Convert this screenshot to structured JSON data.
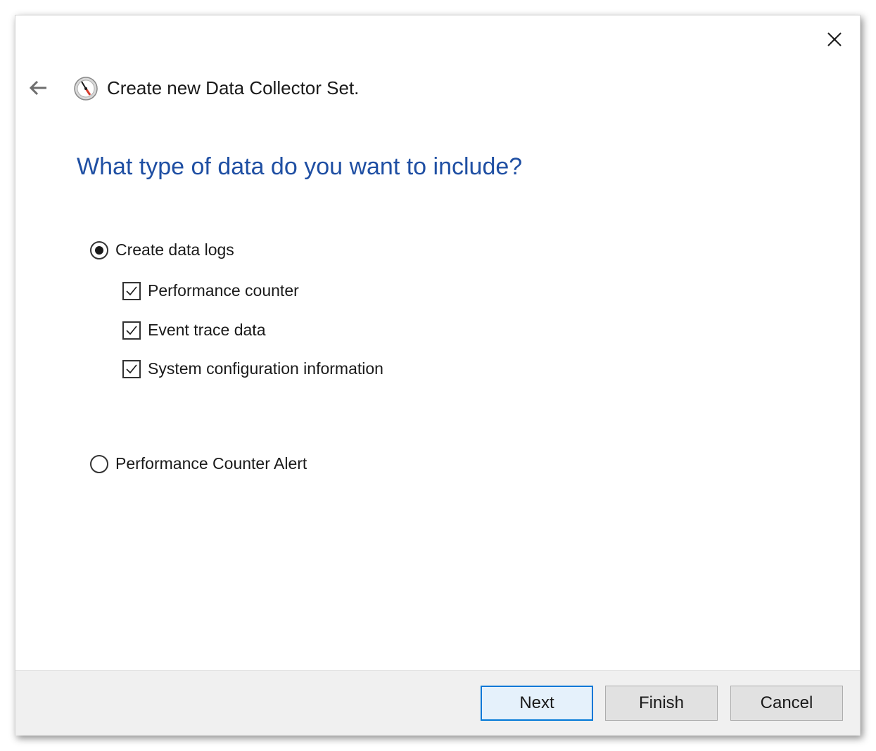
{
  "header": {
    "title": "Create new Data Collector Set."
  },
  "main": {
    "heading": "What type of data do you want to include?",
    "options": [
      {
        "label": "Create data logs",
        "selected": true,
        "checkboxes": [
          {
            "label": "Performance counter",
            "checked": true
          },
          {
            "label": "Event trace data",
            "checked": true
          },
          {
            "label": "System configuration information",
            "checked": true
          }
        ]
      },
      {
        "label": "Performance Counter Alert",
        "selected": false
      }
    ]
  },
  "footer": {
    "next_label": "Next",
    "finish_label": "Finish",
    "cancel_label": "Cancel"
  },
  "icons": {
    "close": "close-icon",
    "back": "back-arrow-icon",
    "app": "performance-monitor-icon"
  },
  "colors": {
    "heading": "#1f4fa3",
    "accent_border": "#0078d7",
    "footer_bg": "#f0f0f0"
  }
}
